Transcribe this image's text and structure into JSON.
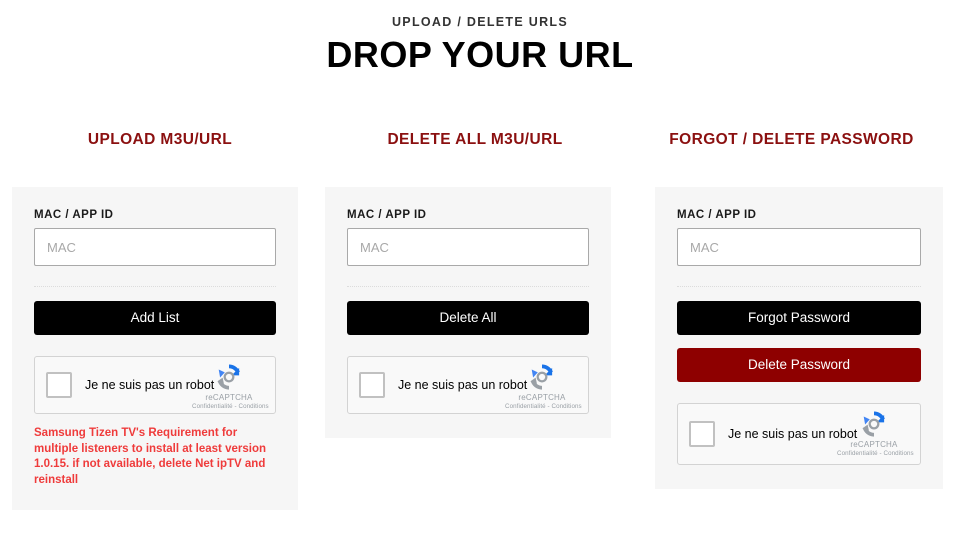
{
  "header": {
    "subtitle": "UPLOAD / DELETE URLS",
    "title": "DROP YOUR URL"
  },
  "colors": {
    "heading_red": "#8B1010",
    "button_black": "#000000",
    "button_red": "#8e0000",
    "warning_red": "#ef3b3b",
    "card_background": "#f6f6f6",
    "page_background": "#ffffff"
  },
  "recaptcha": {
    "label": "Je ne suis pas un robot",
    "brand": "reCAPTCHA",
    "terms": "Confidentialité - Conditions",
    "checkbox_checked": false,
    "logo_icon": "recaptcha-refresh-icon"
  },
  "columns": [
    {
      "heading": "UPLOAD M3U/URL",
      "field_label": "MAC / APP ID",
      "input_placeholder": "MAC",
      "input_value": "",
      "buttons": [
        {
          "label": "Add List",
          "style": "black"
        }
      ],
      "warning": "Samsung Tizen TV's Requirement for multiple listeners to install at least version 1.0.15. if not available, delete Net ipTV and reinstall"
    },
    {
      "heading": "DELETE ALL M3U/URL",
      "field_label": "MAC / APP ID",
      "input_placeholder": "MAC",
      "input_value": "",
      "buttons": [
        {
          "label": "Delete All",
          "style": "black"
        }
      ],
      "warning": ""
    },
    {
      "heading": "FORGOT / DELETE PASSWORD",
      "field_label": "MAC / APP ID",
      "input_placeholder": "MAC",
      "input_value": "",
      "buttons": [
        {
          "label": "Forgot Password",
          "style": "black"
        },
        {
          "label": "Delete Password",
          "style": "red"
        }
      ],
      "warning": ""
    }
  ]
}
